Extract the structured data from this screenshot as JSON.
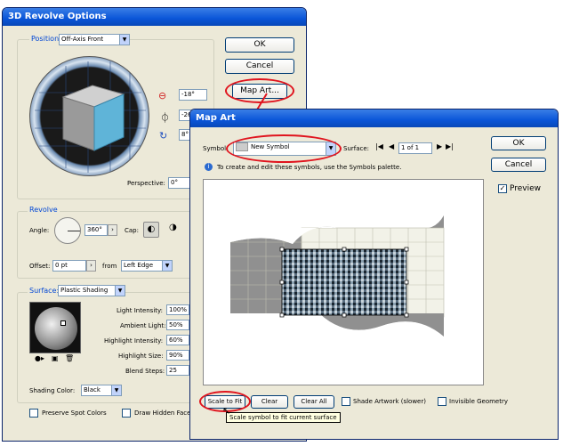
{
  "revolve": {
    "title": "3D Revolve Options",
    "position_label": "Position:",
    "position_value": "Off-Axis Front",
    "ok": "OK",
    "cancel": "Cancel",
    "map_art": "Map Art...",
    "rot_x": "-18°",
    "rot_y": "-26",
    "rot_z": "8°",
    "perspective_label": "Perspective:",
    "perspective_value": "0°",
    "revolve_group": "Revolve",
    "angle_label": "Angle:",
    "angle_value": "360°",
    "cap_label": "Cap:",
    "offset_label": "Offset:",
    "offset_value": "0 pt",
    "from_label": "from",
    "from_value": "Left Edge",
    "surface_label": "Surface:",
    "surface_value": "Plastic Shading",
    "light_intensity_label": "Light Intensity:",
    "light_intensity": "100%",
    "ambient_light_label": "Ambient Light:",
    "ambient_light": "50%",
    "highlight_intensity_label": "Highlight Intensity:",
    "highlight_intensity": "60%",
    "highlight_size_label": "Highlight Size:",
    "highlight_size": "90%",
    "blend_steps_label": "Blend Steps:",
    "blend_steps": "25",
    "shading_color_label": "Shading Color:",
    "shading_color": "Black",
    "preserve_spot": "Preserve Spot Colors",
    "draw_hidden": "Draw Hidden Face"
  },
  "mapart": {
    "title": "Map Art",
    "symbol_label": "Symbol:",
    "symbol_value": "New Symbol",
    "surface_label": "Surface:",
    "surface_value": "1 of 1",
    "hint": "To create and edit these symbols, use the Symbols palette.",
    "ok": "OK",
    "cancel": "Cancel",
    "preview_label": "Preview",
    "scale_to_fit": "Scale to Fit",
    "clear": "Clear",
    "clear_all": "Clear All",
    "shade_artwork": "Shade Artwork (slower)",
    "invisible_geometry": "Invisible Geometry",
    "tooltip": "Scale symbol to fit current surface"
  },
  "colors": {
    "accent_red": "#e0141e",
    "title_blue": "#0a55d8",
    "cube_face": "#5fb4d8"
  }
}
